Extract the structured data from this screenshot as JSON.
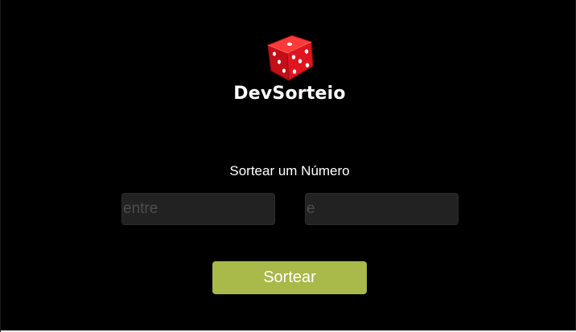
{
  "brand": {
    "name": "DevSorteio",
    "icon": "red-dice-icon"
  },
  "form": {
    "title": "Sortear um Número",
    "min_placeholder": "entre",
    "max_placeholder": "e",
    "submit_label": "Sortear"
  },
  "colors": {
    "background": "#000000",
    "button": "#a9b94a",
    "input_background": "#222222",
    "dice": "#e0141e"
  }
}
